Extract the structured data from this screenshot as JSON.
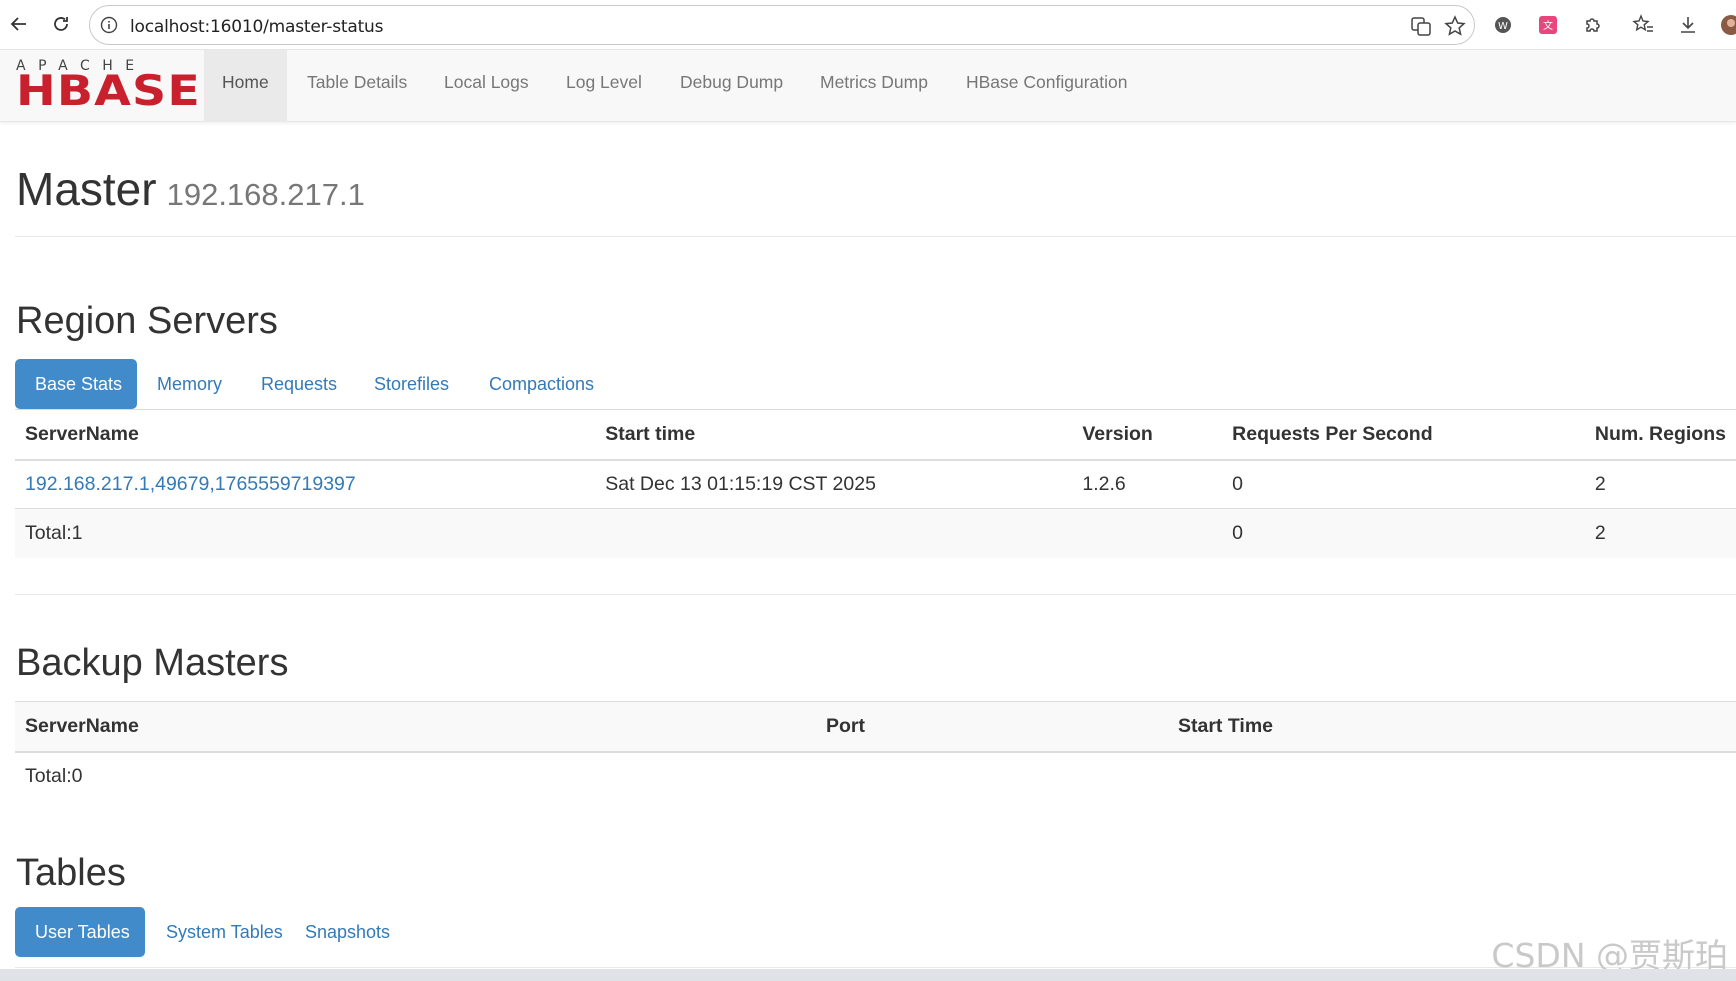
{
  "browser": {
    "url": "localhost:16010/master-status"
  },
  "nav": {
    "logo_top": "APACHE",
    "logo_main": "HBASE",
    "items": [
      {
        "label": "Home"
      },
      {
        "label": "Table Details"
      },
      {
        "label": "Local Logs"
      },
      {
        "label": "Log Level"
      },
      {
        "label": "Debug Dump"
      },
      {
        "label": "Metrics Dump"
      },
      {
        "label": "HBase Configuration"
      }
    ]
  },
  "header": {
    "title": "Master",
    "host": "192.168.217.1"
  },
  "region_servers": {
    "title": "Region Servers",
    "tabs": [
      {
        "label": "Base Stats"
      },
      {
        "label": "Memory"
      },
      {
        "label": "Requests"
      },
      {
        "label": "Storefiles"
      },
      {
        "label": "Compactions"
      }
    ],
    "columns": [
      "ServerName",
      "Start time",
      "Version",
      "Requests Per Second",
      "Num. Regions"
    ],
    "rows": [
      [
        "192.168.217.1,49679,1765559719397",
        "Sat Dec 13 01:15:19 CST 2025",
        "1.2.6",
        "0",
        "2"
      ]
    ],
    "total": {
      "label": "Total:1",
      "requests": "0",
      "regions": "2"
    }
  },
  "backup_masters": {
    "title": "Backup Masters",
    "columns": [
      "ServerName",
      "Port",
      "Start Time"
    ],
    "total": "Total:0"
  },
  "tables": {
    "title": "Tables",
    "tabs": [
      {
        "label": "User Tables"
      },
      {
        "label": "System Tables"
      },
      {
        "label": "Snapshots"
      }
    ]
  },
  "watermark": "CSDN @贾斯珀",
  "colors": {
    "brand": "#c8202d",
    "tab_active": "#428bca",
    "link": "#337ab7"
  }
}
